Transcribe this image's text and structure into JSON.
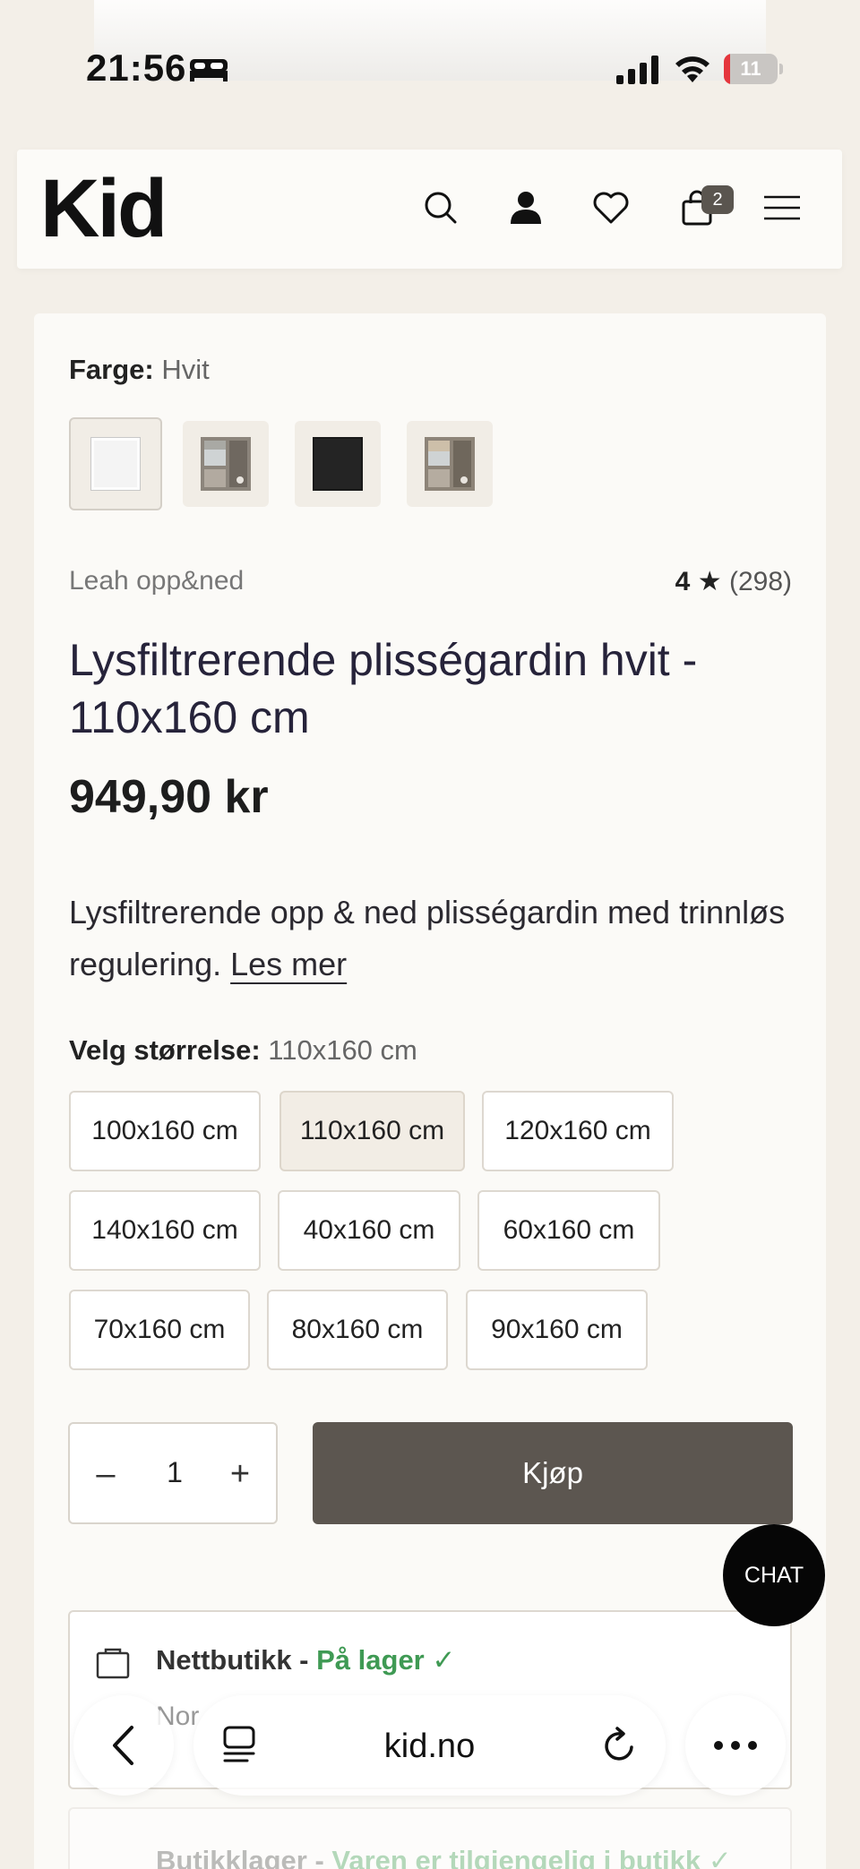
{
  "status_bar": {
    "time": "21:56",
    "battery": "11",
    "battery_level": 0.11,
    "icons": [
      "bed-icon",
      "signal-icon",
      "wifi-icon",
      "battery-icon"
    ]
  },
  "header": {
    "logo": "Kid",
    "cart_count": "2",
    "icons": [
      "search-icon",
      "account-icon",
      "heart-icon",
      "cart-icon",
      "menu-icon"
    ]
  },
  "product": {
    "color_label": "Farge:",
    "color_value": "Hvit",
    "swatches": [
      "white-blind",
      "grey-blind-room",
      "black-blind",
      "beige-blind-room"
    ],
    "brand": "Leah opp&ned",
    "rating_value": "4",
    "rating_star": "★",
    "rating_count": "(298)",
    "title": "Lysfiltrerende plisségardin hvit - 110x160 cm",
    "price": "949,90 kr",
    "description": "Lysfiltrerende opp & ned plisségardin med trinnløs regulering.",
    "read_more": "Les mer",
    "size_label": "Velg størrelse:",
    "size_value": "110x160 cm",
    "sizes": [
      "100x160 cm",
      "110x160 cm",
      "120x160 cm",
      "140x160 cm",
      "40x160 cm",
      "60x160 cm",
      "70x160 cm",
      "80x160 cm",
      "90x160 cm"
    ],
    "selected_size": "110x160 cm",
    "quantity": "1",
    "qty_minus": "–",
    "qty_plus": "+",
    "buy_label": "Kjøp"
  },
  "stock": {
    "online_label": "Nettbutikk - ",
    "online_status": "På lager ✓",
    "online_sub": "Nor",
    "store_label": "Butikklager - ",
    "store_status": "Varen er tilgjengelig i butikk ✓"
  },
  "chat_label": "CHAT",
  "browser": {
    "url": "kid.no",
    "icons": [
      "back-icon",
      "tabs-icon",
      "reload-icon",
      "more-icon"
    ]
  },
  "colors": {
    "background": "#f3efe8",
    "card": "#fbfaf7",
    "buy_button": "#5c5650",
    "in_stock_green": "#3f9a54",
    "chat": "#060606"
  }
}
